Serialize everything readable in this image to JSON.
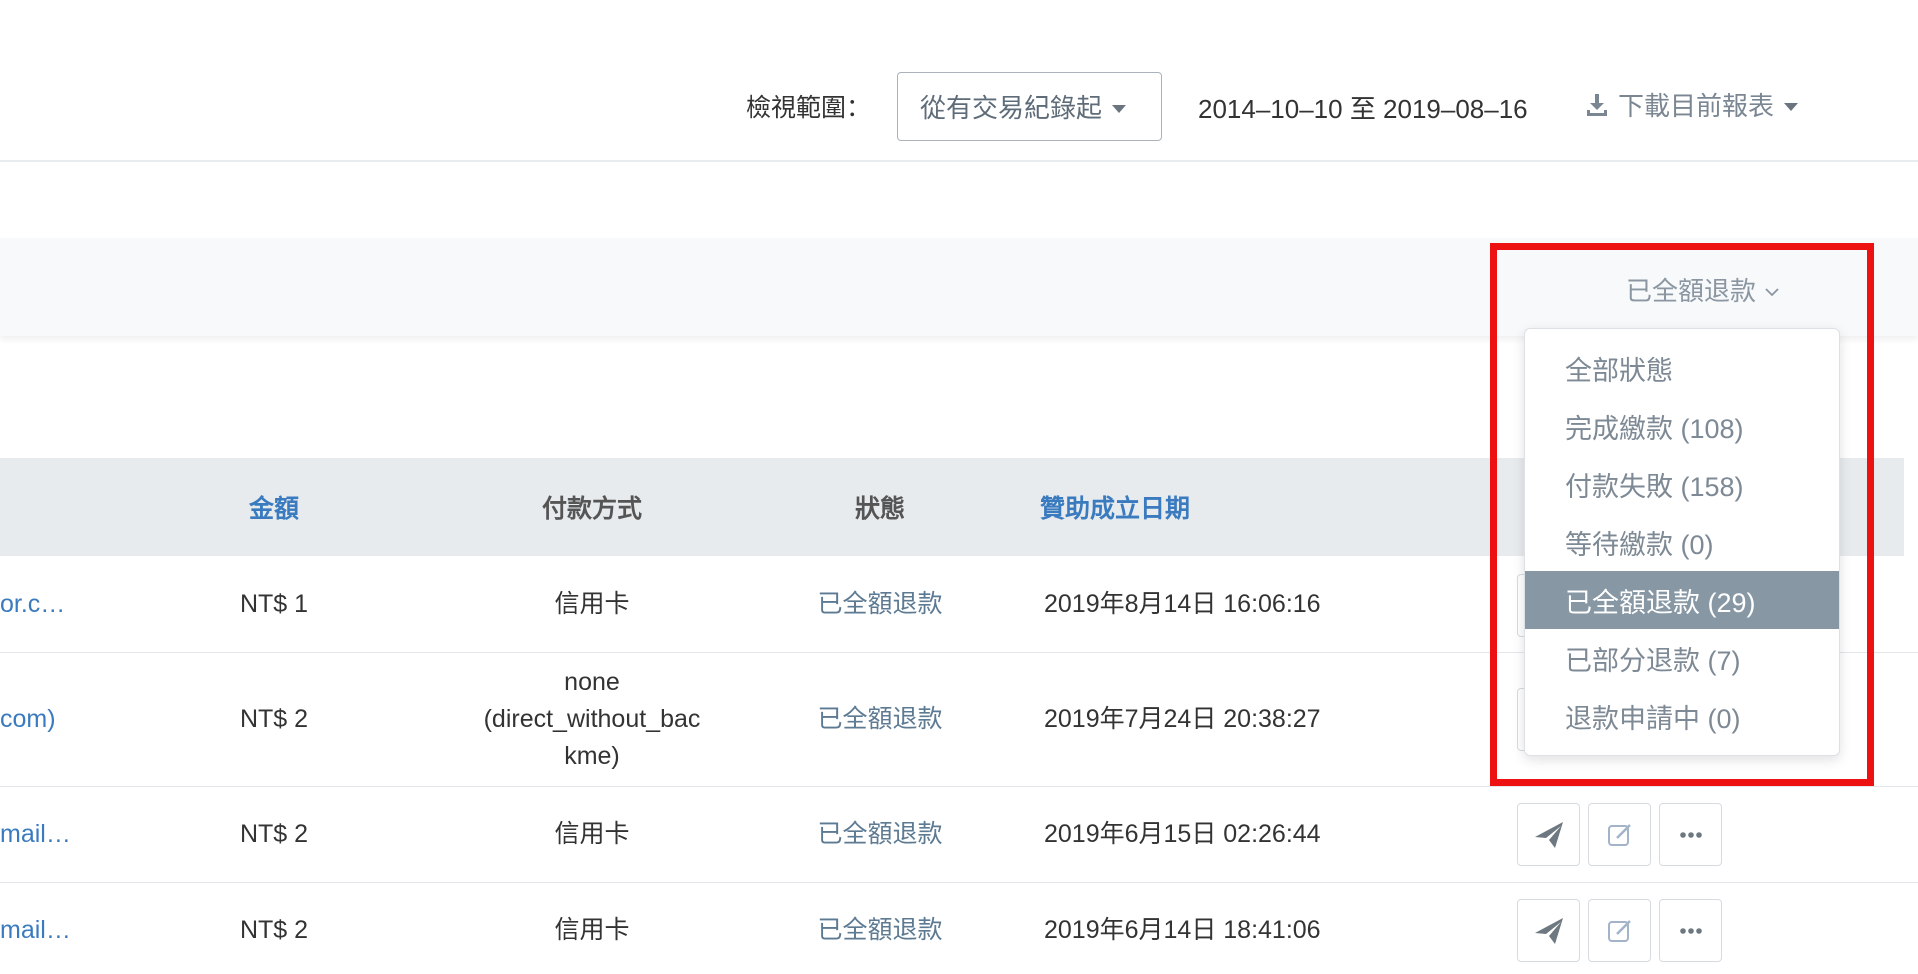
{
  "header": {
    "range_label": "檢視範圍：",
    "range_select_value": "從有交易紀錄起",
    "date_range": "2014–10–10 至 2019–08–16",
    "download_label": "下載目前報表"
  },
  "filter": {
    "status_selected": "已全額退款",
    "options": [
      "全部狀態",
      "完成繳款 (108)",
      "付款失敗 (158)",
      "等待繳款 (0)",
      "已全額退款 (29)",
      "已部分退款 (7)",
      "退款申請中 (0)"
    ],
    "active_index": 4
  },
  "table": {
    "headers": {
      "amount": "金額",
      "payment_method": "付款方式",
      "status": "狀態",
      "date": "贊助成立日期"
    },
    "rows": [
      {
        "email": "or.c…",
        "amount": "NT$ 1",
        "payment_method": "信用卡",
        "status": "已全額退款",
        "date": "2019年8月14日 16:06:16"
      },
      {
        "email": "com)",
        "amount": "NT$ 2",
        "payment_method": "none\n(direct_without_bac\nkme)",
        "status": "已全額退款",
        "date": "2019年7月24日 20:38:27"
      },
      {
        "email": "mail…",
        "amount": "NT$ 2",
        "payment_method": "信用卡",
        "status": "已全額退款",
        "date": "2019年6月15日 02:26:44"
      },
      {
        "email": "mail…",
        "amount": "NT$ 2",
        "payment_method": "信用卡",
        "status": "已全額退款",
        "date": "2019年6月14日 18:41:06"
      }
    ]
  },
  "colors": {
    "link": "#3a7bbf",
    "status": "#5d7a93",
    "highlight": "#ee1111",
    "active_item_bg": "#8797a4"
  },
  "icons": [
    "download-icon",
    "chevron-down-icon",
    "send-icon",
    "edit-icon",
    "more-icon"
  ]
}
